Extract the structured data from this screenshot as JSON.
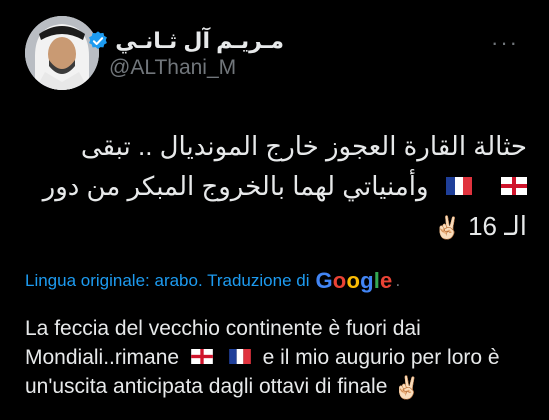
{
  "author": {
    "display_name": "مـريـم آل ثـانـي",
    "handle": "@ALThani_M",
    "verified": true,
    "avatar_icon": "profile-photo"
  },
  "tweet": {
    "original_lines": [
      "حثالة القارة العجوز خارج المونديال .. تبقى",
      "وأمنياتي لهما بالخروج المبكر من دور",
      "الـ 16"
    ],
    "translate_label": "Lingua originale: arabo. Traduzione di",
    "translate_provider": "Google",
    "translate_suffix": ".",
    "translation_lines": [
      "La feccia del vecchio continente è fuori dai",
      "Mondiali..rimane",
      "e il mio augurio per loro è",
      "un'uscita anticipata dagli ottavi di finale"
    ],
    "emojis": [
      "england-flag-icon",
      "france-flag-icon",
      "victory-hand-icon"
    ]
  },
  "colors": {
    "background": "#000000",
    "text": "#e7e9ea",
    "secondary": "#71767b",
    "accent": "#1d9bf0",
    "verified": "#1d9bf0"
  }
}
